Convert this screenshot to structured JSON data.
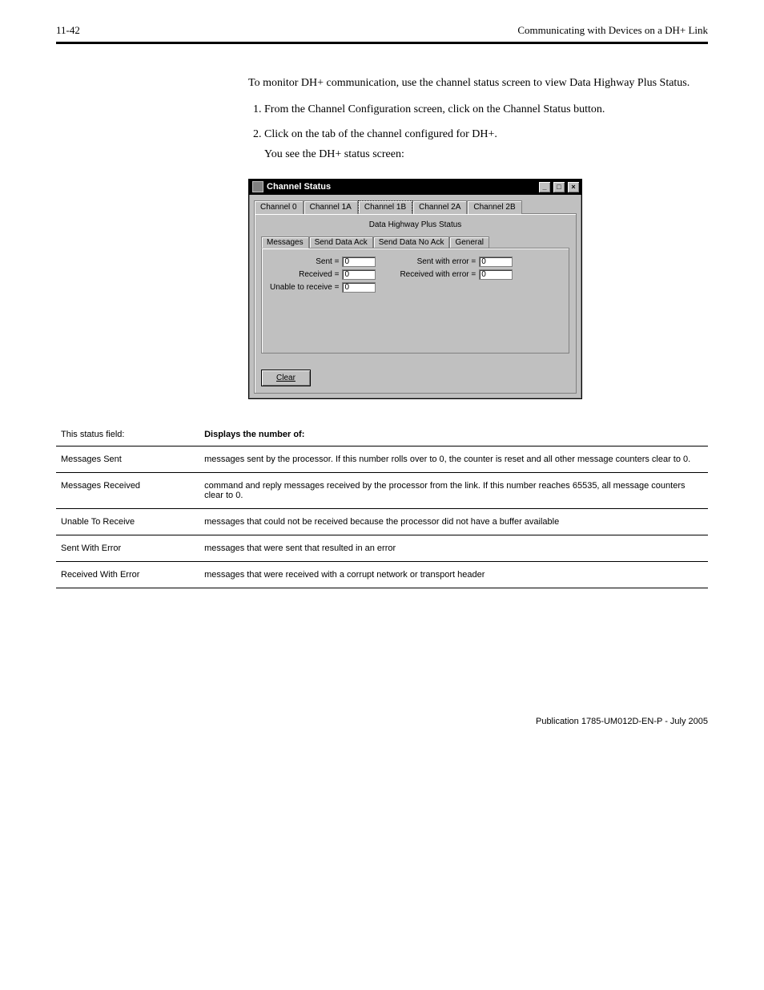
{
  "header": {
    "page_num": "11-42",
    "doc_title": "Communicating with Devices on a DH+ Link"
  },
  "intro": {
    "lead": "To monitor DH+ communication, use the channel status screen to view Data Highway Plus Status.",
    "steps": [
      "From the Channel Configuration screen, click on the Channel Status button.",
      "Click on the tab of the channel configured for DH+."
    ],
    "you_see": "You see the DH+ status screen:"
  },
  "window": {
    "title": "Channel Status",
    "outer_tabs": [
      "Channel 0",
      "Channel 1A",
      "Channel 1B",
      "Channel 2A",
      "Channel 2B"
    ],
    "outer_active": 2,
    "panel_title": "Data Highway Plus Status",
    "inner_tabs": [
      "Messages",
      "Send Data Ack",
      "Send Data No Ack",
      "General"
    ],
    "inner_active": 0,
    "fields_left": [
      {
        "label": "Sent =",
        "value": "0"
      },
      {
        "label": "Received =",
        "value": "0"
      },
      {
        "label": "Unable to receive =",
        "value": "0"
      }
    ],
    "fields_right": [
      {
        "label": "Sent with error =",
        "value": "0"
      },
      {
        "label": "Received with error =",
        "value": "0"
      }
    ],
    "clear_label": "Clear"
  },
  "table": {
    "headers": [
      "This status field:",
      "Displays the number of:"
    ],
    "rows": [
      {
        "c1": "Messages Sent",
        "c2": "messages sent by the processor. If this number rolls over to 0, the counter is reset and all other message counters clear to 0."
      },
      {
        "c1": "Messages Received",
        "c2": "command and reply messages received by the processor from the link. If this number reaches 65535, all message counters clear to 0."
      },
      {
        "c1": "Unable To Receive",
        "c2": "messages that could not be received because the processor did not have a buffer available"
      },
      {
        "c1": "Sent With Error",
        "c2": "messages that were sent that resulted in an error"
      },
      {
        "c1": "Received With Error",
        "c2": "messages that were received with a corrupt network or transport header"
      }
    ]
  },
  "footer": {
    "pub": "Publication 1785-UM012D-EN-P - July 2005"
  }
}
